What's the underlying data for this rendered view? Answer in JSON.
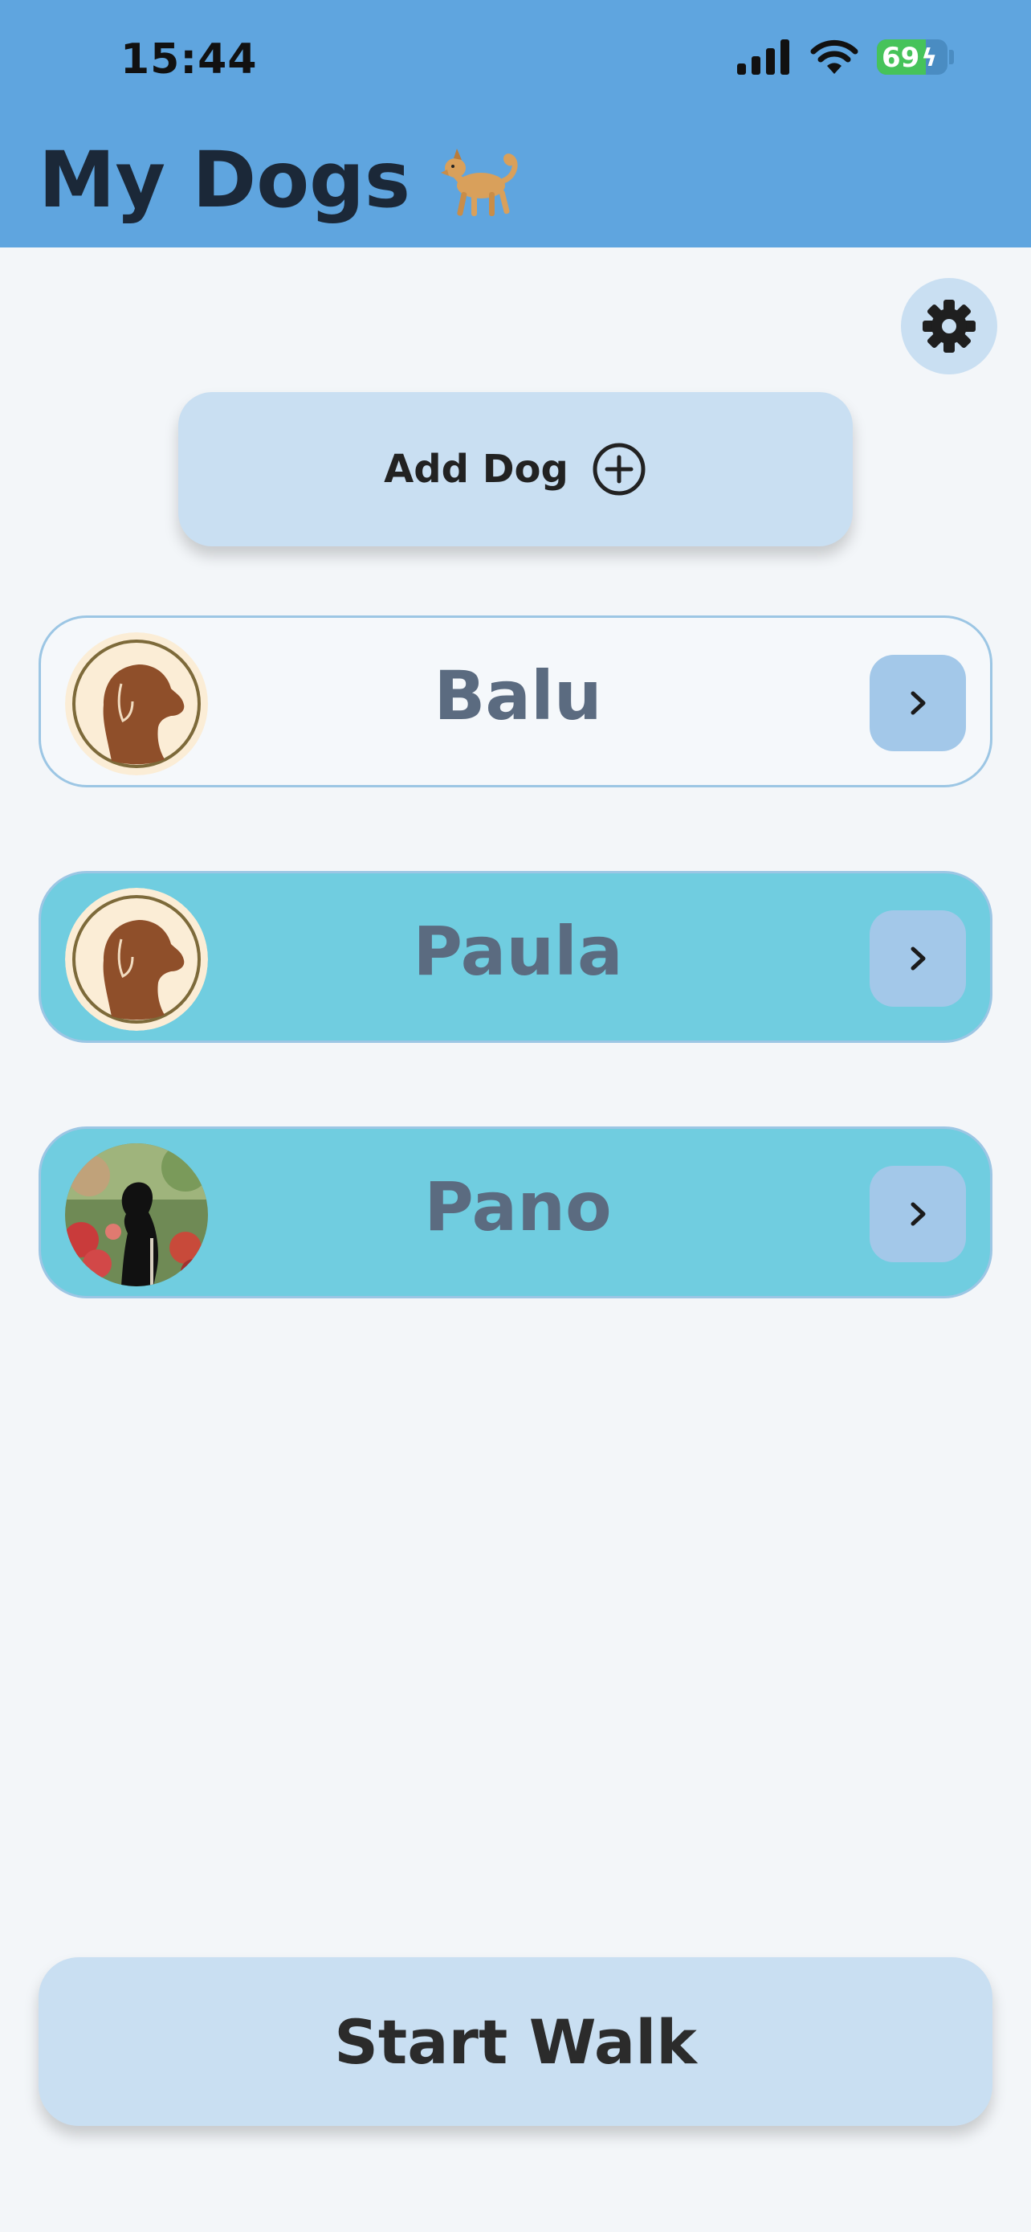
{
  "status_bar": {
    "time": "15:44",
    "battery": "69",
    "battery_level": 0.69,
    "icons": [
      "signal-icon",
      "wifi-icon",
      "battery-icon",
      "charging-bolt-icon"
    ]
  },
  "header": {
    "title": "My Dogs",
    "icon": "dog-emoji-icon"
  },
  "toolbar": {
    "settings_icon": "gear-icon"
  },
  "add_dog": {
    "label": "Add Dog",
    "icon": "plus-circle-icon"
  },
  "dogs": [
    {
      "name": "Balu",
      "avatar": "dog-head-silhouette-icon",
      "style": "white"
    },
    {
      "name": "Paula",
      "avatar": "dog-head-silhouette-icon",
      "style": "teal"
    },
    {
      "name": "Pano",
      "avatar": "dog-photo",
      "style": "teal"
    }
  ],
  "start_walk": {
    "label": "Start Walk"
  },
  "colors": {
    "header": "#5fa5df",
    "background": "#f3f6f9",
    "button": "#c9dff2",
    "card_teal": "#70cde0",
    "chevron_button": "#a3c8e9",
    "dog_name": "#5b6b80",
    "title": "#1b2838"
  }
}
